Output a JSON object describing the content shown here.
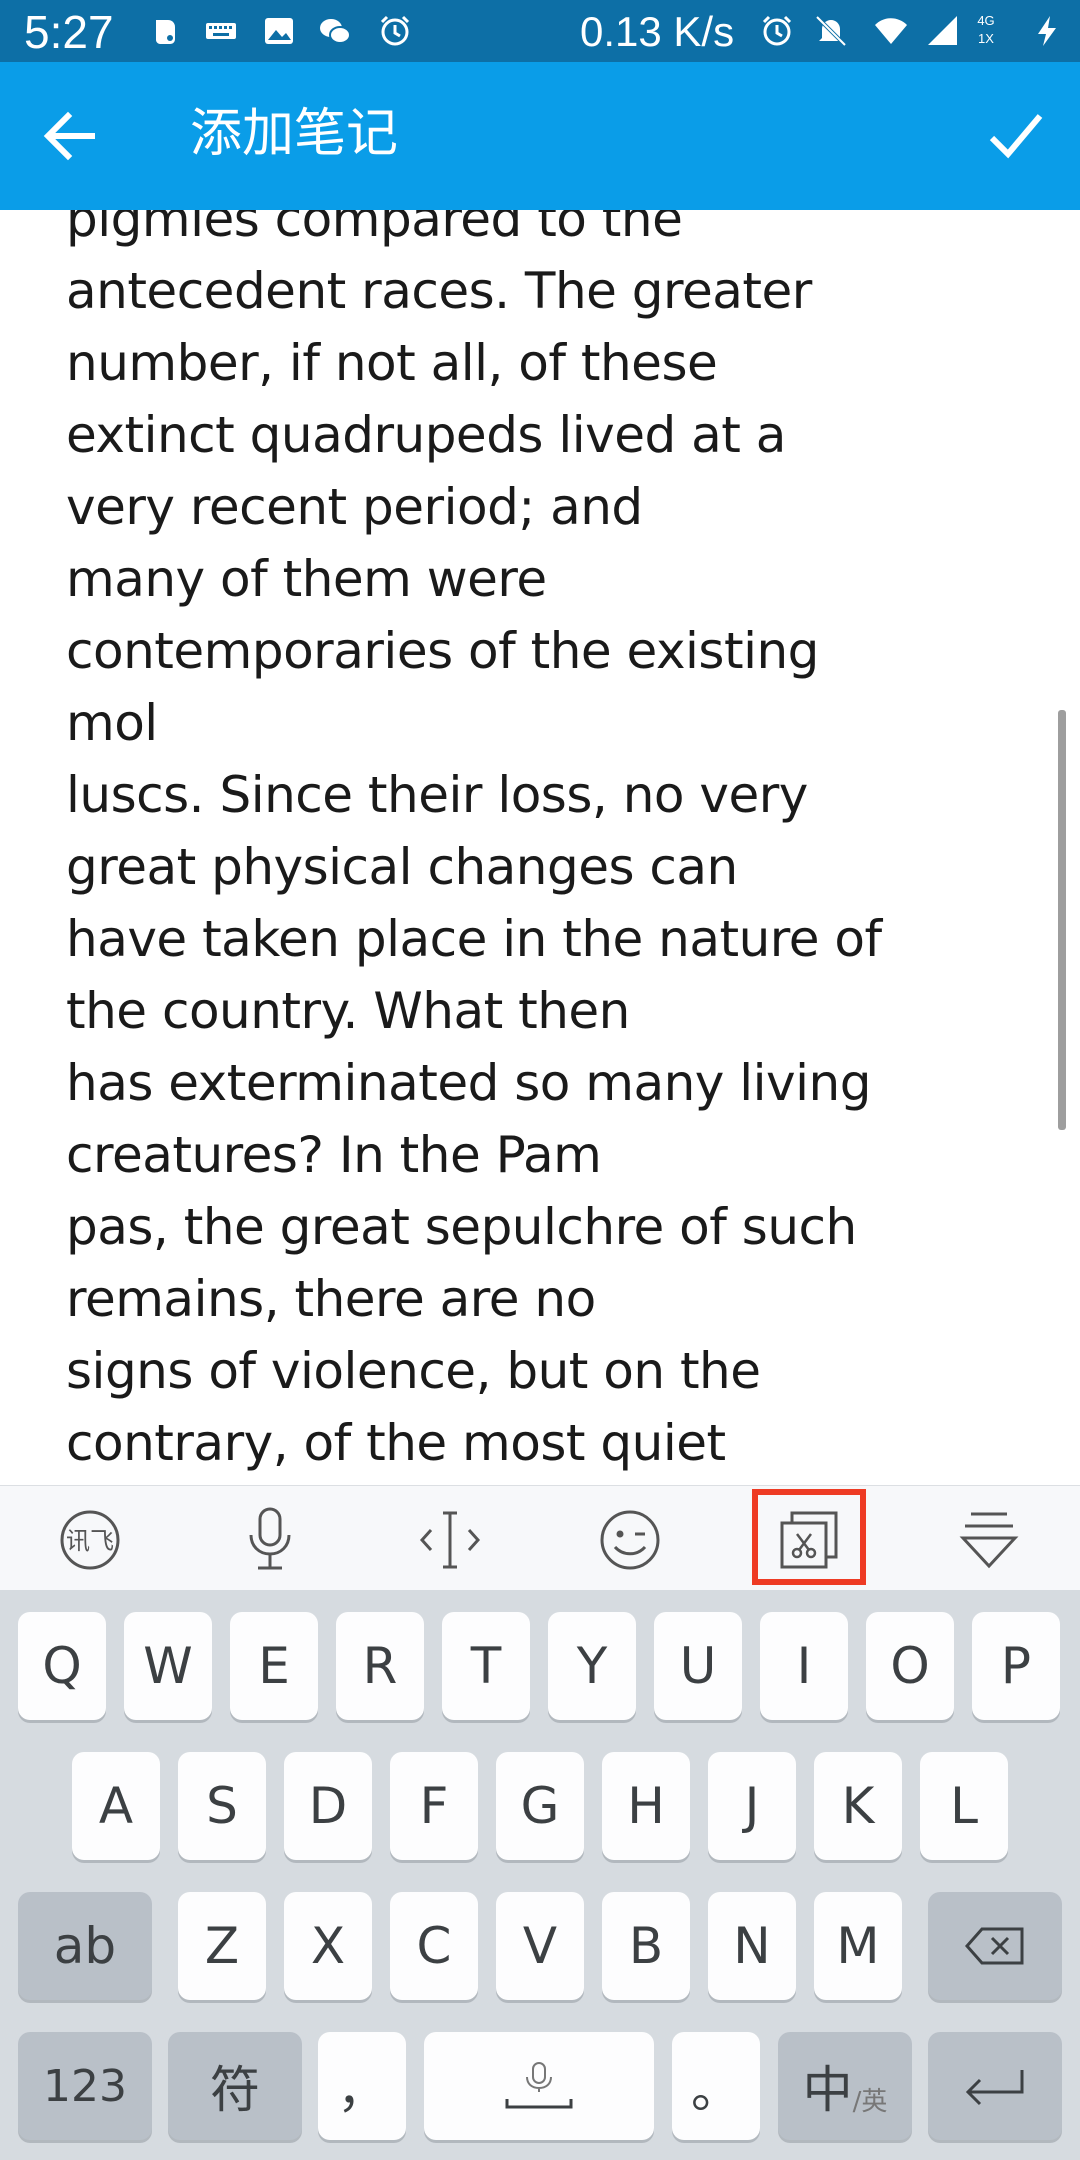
{
  "status_bar": {
    "time": "5:27",
    "network_speed": "0.13 K/s",
    "network_type": "4G",
    "sim": "1X",
    "icons": [
      "evernote-icon",
      "keyboard-icon",
      "image-icon",
      "wechat-icon",
      "alarm-icon",
      "alarm-icon",
      "mute-icon",
      "wifi-icon",
      "signal-icon",
      "charging-icon"
    ]
  },
  "app_bar": {
    "title": "添加笔记",
    "back_icon": "arrow-left-icon",
    "confirm_icon": "check-icon"
  },
  "note": {
    "lines": [
      "pigmies compared to the",
      "antecedent races. The greater",
      "number, if not all, of these",
      "extinct quadrupeds lived at a",
      "very recent period; and",
      "many of them were",
      "contemporaries of the existing",
      "mol",
      "luscs. Since their loss, no very",
      "great physical changes can",
      "have taken place in the nature of",
      "the country. What then",
      "has exterminated so many living",
      "creatures? In the Pam",
      "pas, the great sepulchre of such",
      "remains, there are no",
      "signs of violence, but on the",
      "contrary, of the most quiet"
    ]
  },
  "keyboard_toolbar": {
    "items": [
      "iflytek-logo-icon",
      "microphone-icon",
      "cursor-move-icon",
      "emoji-icon",
      "clipboard-icon",
      "hide-keyboard-icon"
    ],
    "highlighted": "clipboard-icon",
    "highlight_color": "#ee3b24"
  },
  "keyboard": {
    "row1": [
      "Q",
      "W",
      "E",
      "R",
      "T",
      "Y",
      "U",
      "I",
      "O",
      "P"
    ],
    "row2": [
      "A",
      "S",
      "D",
      "F",
      "G",
      "H",
      "J",
      "K",
      "L"
    ],
    "row3": {
      "shift": "ab",
      "letters": [
        "Z",
        "X",
        "C",
        "V",
        "B",
        "N",
        "M"
      ],
      "delete_icon": "backspace-icon"
    },
    "row4": {
      "numbers": "123",
      "symbols": "符",
      "comma": "，",
      "space_icon": "microphone-icon",
      "period": "。",
      "lang_main": "中",
      "lang_sub": "/英",
      "enter_icon": "enter-icon"
    }
  },
  "colors": {
    "status_bar": "#0d6fa6",
    "app_bar": "#0a9de8",
    "keyboard_bg": "#d6dbe0"
  }
}
